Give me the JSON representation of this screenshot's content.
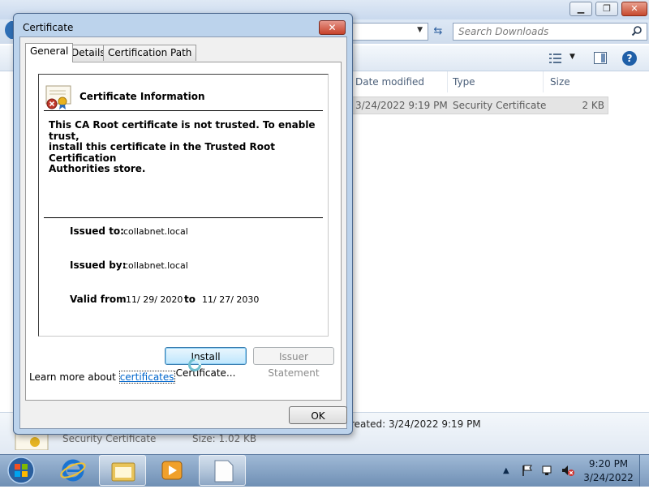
{
  "explorer": {
    "search_placeholder": "Search Downloads",
    "columns": {
      "date_modified": "Date modified",
      "type": "Type",
      "size": "Size"
    },
    "file": {
      "date_modified": "3/24/2022 9:19 PM",
      "type": "Security Certificate",
      "size": "2 KB"
    },
    "details": {
      "created": "reated: 3/24/2022 9:19 PM",
      "type": "Security Certificate",
      "size": "Size: 1.02 KB"
    }
  },
  "dialog": {
    "title": "Certificate",
    "close_glyph": "✕",
    "tabs": [
      "General",
      "Details",
      "Certification Path"
    ],
    "heading": "Certificate Information",
    "message": "This CA Root certificate is not trusted. To enable trust,\ninstall this certificate in the Trusted Root Certification\nAuthorities store.",
    "issued_to_label": "Issued to:",
    "issued_to": "collabnet.local",
    "issued_by_label": "Issued by:",
    "issued_by": "collabnet.local",
    "valid_from_label": "Valid from",
    "valid_from": "11/ 29/ 2020",
    "to_label": "to",
    "valid_to": "11/ 27/ 2030",
    "install_button": "Install Certificate...",
    "issuer_button": "Issuer Statement",
    "learn_more": "Learn more about",
    "learn_link": "certificates",
    "ok_button": "OK"
  },
  "taskbar": {
    "time": "9:20 PM",
    "date": "3/24/2022",
    "tray_expand_glyph": "▲"
  },
  "icons": {
    "cert_icon": "certificate-with-error-icon",
    "search": "search-icon",
    "help": "help-icon"
  },
  "colors": {
    "dialog_frame": "#bcd3ec",
    "link": "#0066cc",
    "close_button": "#c7422a"
  }
}
